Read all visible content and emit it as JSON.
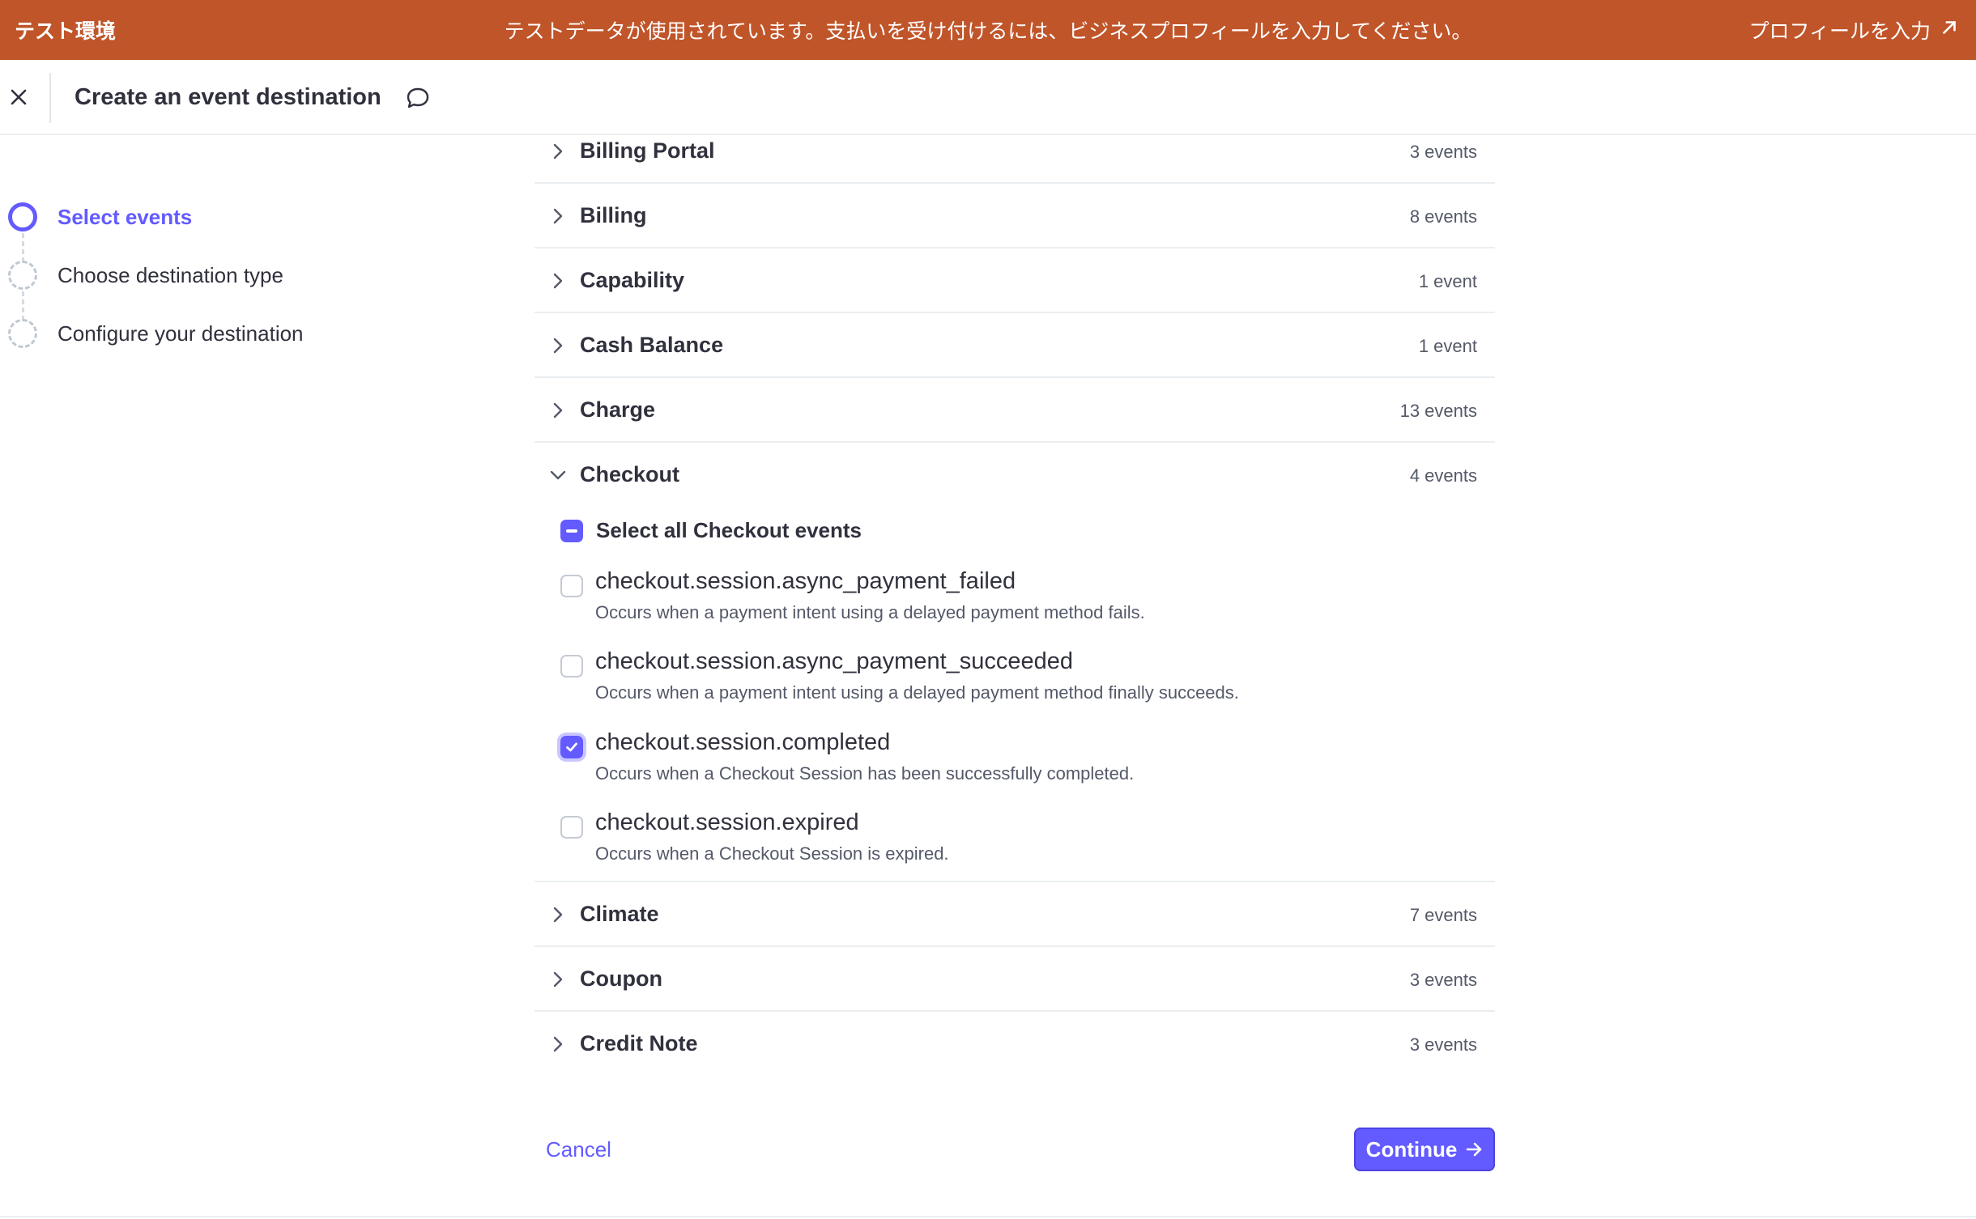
{
  "banner": {
    "env_label": "テスト環境",
    "message": "テストデータが使用されています。支払いを受け付けるには、ビジネスプロフィールを入力してください。",
    "cta_label": "プロフィールを入力",
    "background_color": "#c0552a"
  },
  "header": {
    "title": "Create an event destination"
  },
  "steps": [
    {
      "label": "Select events",
      "state": "active"
    },
    {
      "label": "Choose destination type",
      "state": "pending"
    },
    {
      "label": "Configure your destination",
      "state": "pending"
    }
  ],
  "categories": [
    {
      "name": "Billing Portal",
      "count": "3 events",
      "expanded": false
    },
    {
      "name": "Billing",
      "count": "8 events",
      "expanded": false
    },
    {
      "name": "Capability",
      "count": "1 event",
      "expanded": false
    },
    {
      "name": "Cash Balance",
      "count": "1 event",
      "expanded": false
    },
    {
      "name": "Charge",
      "count": "13 events",
      "expanded": false
    },
    {
      "name": "Checkout",
      "count": "4 events",
      "expanded": true
    },
    {
      "name": "Climate",
      "count": "7 events",
      "expanded": false
    },
    {
      "name": "Coupon",
      "count": "3 events",
      "expanded": false
    },
    {
      "name": "Credit Note",
      "count": "3 events",
      "expanded": false
    }
  ],
  "checkout": {
    "select_all_label": "Select all Checkout events",
    "select_all_state": "indeterminate",
    "events": [
      {
        "name": "checkout.session.async_payment_failed",
        "description": "Occurs when a payment intent using a delayed payment method fails.",
        "checked": false
      },
      {
        "name": "checkout.session.async_payment_succeeded",
        "description": "Occurs when a payment intent using a delayed payment method finally succeeds.",
        "checked": false
      },
      {
        "name": "checkout.session.completed",
        "description": "Occurs when a Checkout Session has been successfully completed.",
        "checked": true
      },
      {
        "name": "checkout.session.expired",
        "description": "Occurs when a Checkout Session is expired.",
        "checked": false
      }
    ]
  },
  "footer": {
    "cancel_label": "Cancel",
    "continue_label": "Continue"
  },
  "colors": {
    "accent": "#635bff",
    "text": "#30313d",
    "muted": "#545969",
    "divider": "#ebeef1"
  }
}
